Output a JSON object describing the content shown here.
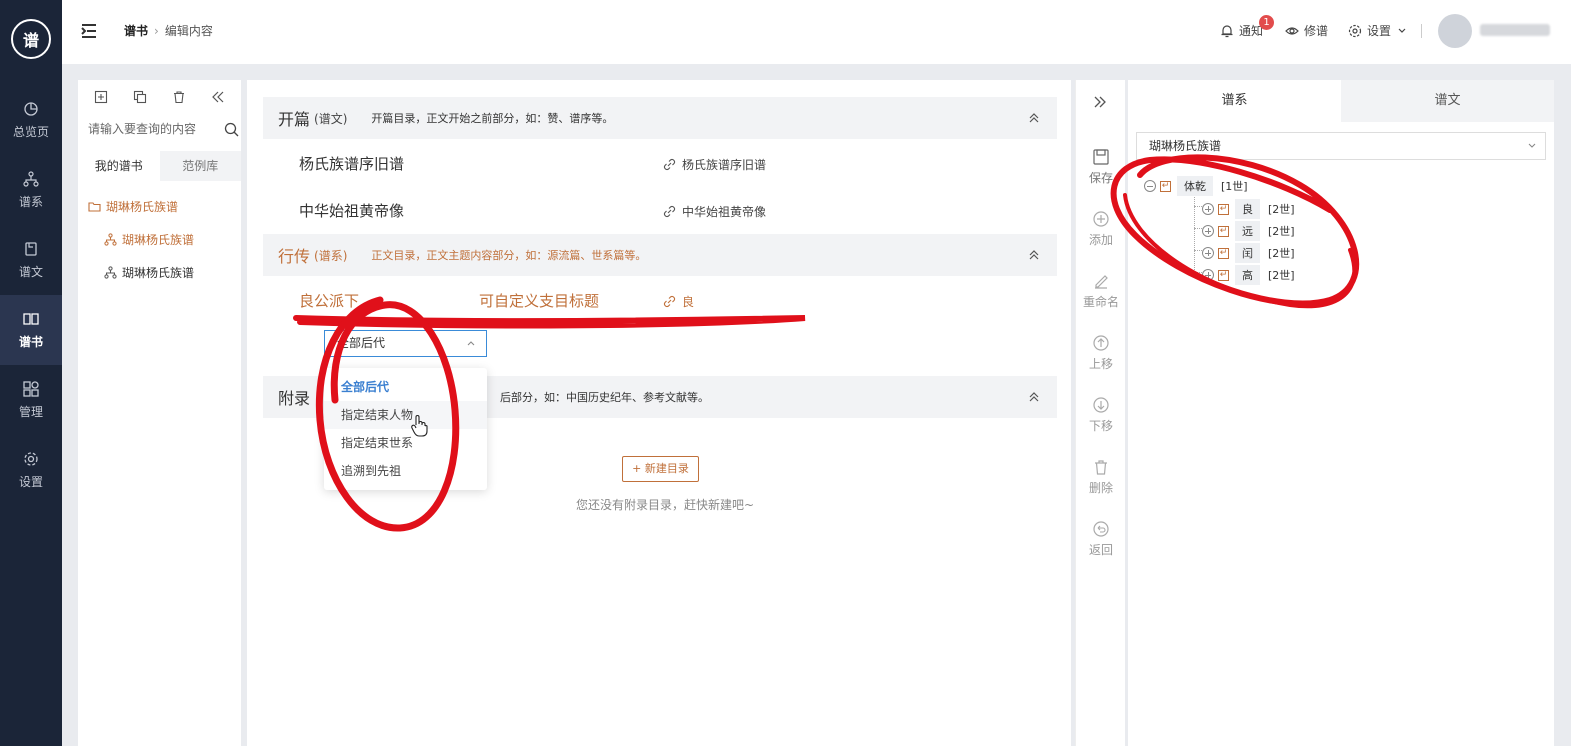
{
  "nav": {
    "logo_text": "谱",
    "items": [
      {
        "label": "总览页",
        "icon": "dashboard-icon"
      },
      {
        "label": "谱系",
        "icon": "tree-icon"
      },
      {
        "label": "谱文",
        "icon": "document-icon"
      },
      {
        "label": "谱书",
        "icon": "book-icon",
        "active": true
      },
      {
        "label": "管理",
        "icon": "grid-icon"
      },
      {
        "label": "设置",
        "icon": "gear-icon"
      }
    ]
  },
  "topbar": {
    "breadcrumb": [
      "谱书",
      "编辑内容"
    ],
    "notify_label": "通知",
    "notify_count": "1",
    "edit_label": "修谱",
    "settings_label": "设置"
  },
  "left": {
    "search_placeholder": "请输入要查询的内容",
    "tabs": [
      "我的谱书",
      "范例库"
    ],
    "tree": {
      "root": "瑚琳杨氏族谱",
      "children": [
        "瑚琳杨氏族谱",
        "瑚琳杨氏族谱"
      ]
    }
  },
  "main": {
    "sections": [
      {
        "title": "开篇",
        "sub": "(谱文)",
        "desc": "开篇目录，正文开始之前部分，如：赞、谱序等。",
        "rows": [
          {
            "title": "杨氏族谱序旧谱",
            "link": "杨氏族谱序旧谱"
          },
          {
            "title": "中华始祖黄帝像",
            "link": "中华始祖黄帝像"
          }
        ]
      },
      {
        "title": "行传",
        "sub": "(谱系)",
        "desc": "正文目录，正文主题内容部分，如：源流篇、世系篇等。",
        "rows": [
          {
            "title": "良公派下",
            "custom": "可自定义支目标题",
            "link": "良"
          }
        ]
      },
      {
        "title": "附录",
        "desc": "后部分，如：中国历史纪年、参考文献等。"
      }
    ],
    "select_value": "全部后代",
    "dropdown_options": [
      "全部后代",
      "指定结束人物",
      "指定结束世系",
      "追溯到先祖"
    ],
    "new_button": "+ 新建目录",
    "empty_tip": "您还没有附录目录，赶快新建吧~"
  },
  "tools": [
    "保存",
    "添加",
    "重命名",
    "上移",
    "下移",
    "删除",
    "返回"
  ],
  "right": {
    "tabs": [
      "谱系",
      "谱文"
    ],
    "select_value": "瑚琳杨氏族谱",
    "root": {
      "name": "体乾",
      "gen": "[1世]"
    },
    "children": [
      {
        "name": "良",
        "gen": "[2世]"
      },
      {
        "name": "远",
        "gen": "[2世]"
      },
      {
        "name": "闰",
        "gen": "[2世]"
      },
      {
        "name": "高",
        "gen": "[2世]"
      }
    ]
  },
  "colors": {
    "accent": "#c0703a",
    "nav_bg": "#1b2538",
    "annotation": "#e0101a",
    "link_blue": "#3a7fd0"
  }
}
